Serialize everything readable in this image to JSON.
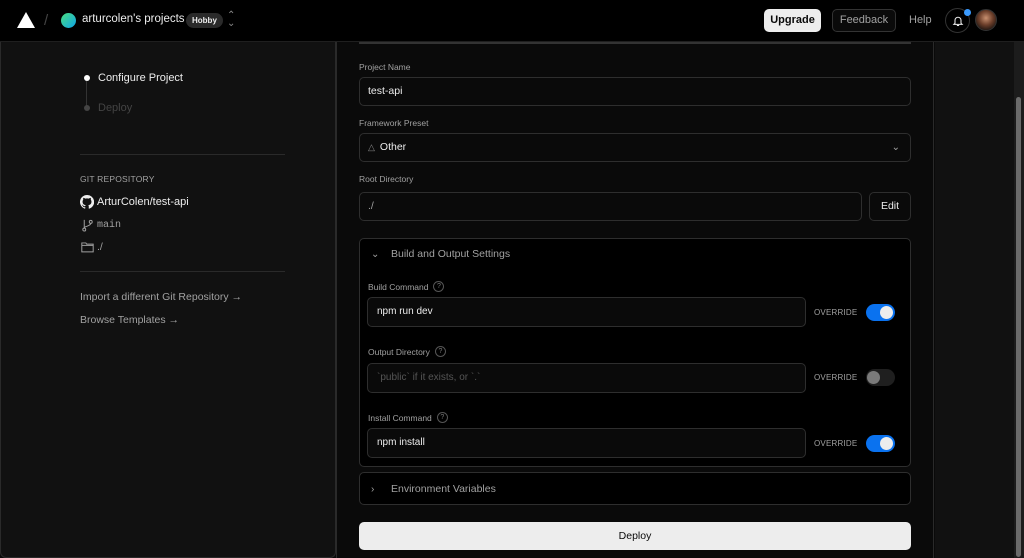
{
  "topbar": {
    "team_name": "arturcolen's projects",
    "plan_badge": "Hobby",
    "upgrade_label": "Upgrade",
    "feedback_label": "Feedback",
    "help_label": "Help",
    "notification_dot_color": "#3b9bff"
  },
  "steps": [
    {
      "label": "Configure Project",
      "state": "current"
    },
    {
      "label": "Deploy",
      "state": "pending"
    }
  ],
  "git": {
    "heading": "GIT REPOSITORY",
    "repo": "ArturColen/test-api",
    "branch": "main",
    "directory": "./"
  },
  "links": {
    "import_repo": "Import a different Git Repository →",
    "browse_templates": "Browse Templates →"
  },
  "form": {
    "project_name": {
      "label": "Project Name",
      "value": "test-api"
    },
    "framework": {
      "label": "Framework Preset",
      "value": "Other"
    },
    "root_directory": {
      "label": "Root Directory",
      "value": "./",
      "edit_label": "Edit"
    },
    "build_settings": {
      "title": "Build and Output Settings",
      "expanded": true,
      "build_command": {
        "label": "Build Command",
        "value": "npm run dev",
        "override_label": "OVERRIDE",
        "override": true
      },
      "output_directory": {
        "label": "Output Directory",
        "placeholder": "`public` if it exists, or `.`",
        "override_label": "OVERRIDE",
        "override": false
      },
      "install_command": {
        "label": "Install Command",
        "value": "npm install",
        "override_label": "OVERRIDE",
        "override": true
      }
    },
    "env_vars": {
      "title": "Environment Variables",
      "expanded": false
    },
    "deploy_label": "Deploy"
  },
  "colors": {
    "accent": "#0a72ef",
    "background": "#0a0a0a",
    "panel": "#111111"
  }
}
